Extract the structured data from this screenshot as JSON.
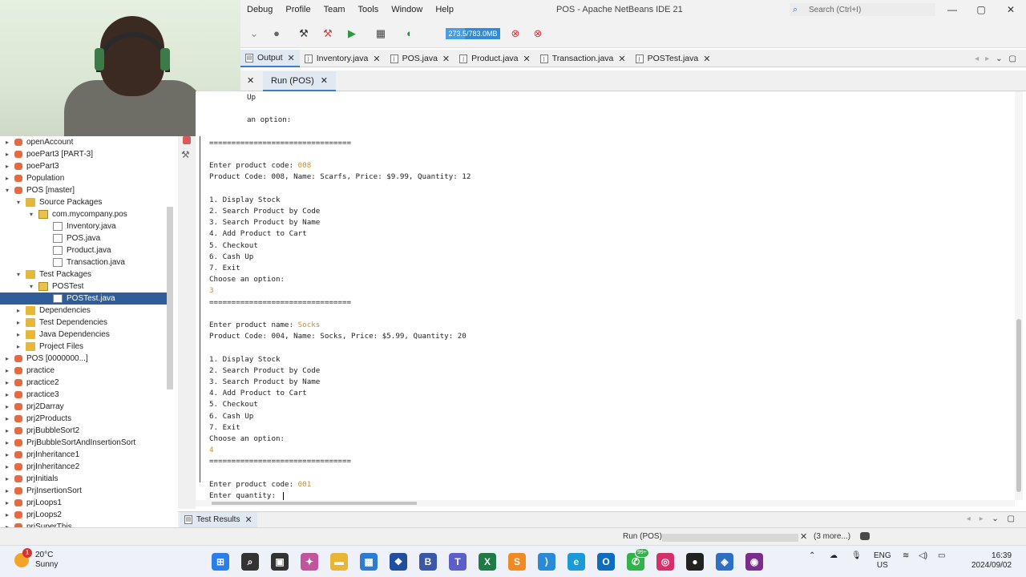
{
  "window": {
    "title": "POS - Apache NetBeans IDE 21",
    "search_placeholder": "Search (Ctrl+I)",
    "minimize": "—",
    "maximize": "▢",
    "close": "✕"
  },
  "menu": [
    "Debug",
    "Profile",
    "Team",
    "Tools",
    "Window",
    "Help"
  ],
  "toolbar": {
    "memory_label": "273.5/783.0MB",
    "memory_used_fraction": 0.35
  },
  "editor_tabs": [
    {
      "label": "Output",
      "active": true
    },
    {
      "label": "Inventory.java",
      "active": false
    },
    {
      "label": "POS.java",
      "active": false
    },
    {
      "label": "Product.java",
      "active": false
    },
    {
      "label": "Transaction.java",
      "active": false
    },
    {
      "label": "POSTest.java",
      "active": false
    }
  ],
  "output_tab": {
    "label": "Run (POS)"
  },
  "console_lines": [
    {
      "text": "Up",
      "input": ""
    },
    {
      "text": "",
      "input": ""
    },
    {
      "text": "an option:",
      "input": ""
    },
    {
      "text": "",
      "input": ""
    },
    {
      "text": "================================",
      "input": ""
    },
    {
      "text": "",
      "input": ""
    },
    {
      "text": "Enter product code: ",
      "input": "008"
    },
    {
      "text": "Product Code: 008, Name: Scarfs, Price: $9.99, Quantity: 12",
      "input": ""
    },
    {
      "text": "",
      "input": ""
    },
    {
      "text": "1. Display Stock",
      "input": ""
    },
    {
      "text": "2. Search Product by Code",
      "input": ""
    },
    {
      "text": "3. Search Product by Name",
      "input": ""
    },
    {
      "text": "4. Add Product to Cart",
      "input": ""
    },
    {
      "text": "5. Checkout",
      "input": ""
    },
    {
      "text": "6. Cash Up",
      "input": ""
    },
    {
      "text": "7. Exit",
      "input": ""
    },
    {
      "text": "Choose an option:",
      "input": ""
    },
    {
      "text": "",
      "input": "3"
    },
    {
      "text": "================================",
      "input": ""
    },
    {
      "text": "",
      "input": ""
    },
    {
      "text": "Enter product name: ",
      "input": "Socks"
    },
    {
      "text": "Product Code: 004, Name: Socks, Price: $5.99, Quantity: 20",
      "input": ""
    },
    {
      "text": "",
      "input": ""
    },
    {
      "text": "1. Display Stock",
      "input": ""
    },
    {
      "text": "2. Search Product by Code",
      "input": ""
    },
    {
      "text": "3. Search Product by Name",
      "input": ""
    },
    {
      "text": "4. Add Product to Cart",
      "input": ""
    },
    {
      "text": "5. Checkout",
      "input": ""
    },
    {
      "text": "6. Cash Up",
      "input": ""
    },
    {
      "text": "7. Exit",
      "input": ""
    },
    {
      "text": "Choose an option:",
      "input": ""
    },
    {
      "text": "",
      "input": "4"
    },
    {
      "text": "================================",
      "input": ""
    },
    {
      "text": "",
      "input": ""
    },
    {
      "text": "Enter product code: ",
      "input": "001"
    },
    {
      "text": "Enter quantity: ",
      "input": ""
    }
  ],
  "project_tree": [
    {
      "label": "openAccount",
      "level": 0,
      "icon": "proj",
      "exp": "▸"
    },
    {
      "label": "poePart3 [PART-3]",
      "level": 0,
      "icon": "proj",
      "exp": "▸"
    },
    {
      "label": "poePart3",
      "level": 0,
      "icon": "proj",
      "exp": "▸"
    },
    {
      "label": "Population",
      "level": 0,
      "icon": "proj",
      "exp": "▸"
    },
    {
      "label": "POS [master]",
      "level": 0,
      "icon": "proj",
      "exp": "▾"
    },
    {
      "label": "Source Packages",
      "level": 1,
      "icon": "folder",
      "exp": "▾"
    },
    {
      "label": "com.mycompany.pos",
      "level": 2,
      "icon": "pkg",
      "exp": "▾"
    },
    {
      "label": "Inventory.java",
      "level": 3,
      "icon": "file",
      "exp": ""
    },
    {
      "label": "POS.java",
      "level": 3,
      "icon": "file",
      "exp": ""
    },
    {
      "label": "Product.java",
      "level": 3,
      "icon": "file",
      "exp": ""
    },
    {
      "label": "Transaction.java",
      "level": 3,
      "icon": "file",
      "exp": ""
    },
    {
      "label": "Test Packages",
      "level": 1,
      "icon": "folder",
      "exp": "▾"
    },
    {
      "label": "POSTest",
      "level": 2,
      "icon": "pkg",
      "exp": "▾"
    },
    {
      "label": "POSTest.java",
      "level": 3,
      "icon": "file",
      "exp": "",
      "selected": true
    },
    {
      "label": "Dependencies",
      "level": 1,
      "icon": "folder",
      "exp": "▸"
    },
    {
      "label": "Test Dependencies",
      "level": 1,
      "icon": "folder",
      "exp": "▸"
    },
    {
      "label": "Java Dependencies",
      "level": 1,
      "icon": "folder",
      "exp": "▸"
    },
    {
      "label": "Project Files",
      "level": 1,
      "icon": "folder",
      "exp": "▸"
    },
    {
      "label": "POS [0000000...]",
      "level": 0,
      "icon": "proj",
      "exp": "▸"
    },
    {
      "label": "practice",
      "level": 0,
      "icon": "proj",
      "exp": "▸"
    },
    {
      "label": "practice2",
      "level": 0,
      "icon": "proj",
      "exp": "▸"
    },
    {
      "label": "practice3",
      "level": 0,
      "icon": "proj",
      "exp": "▸"
    },
    {
      "label": "prj2Darray",
      "level": 0,
      "icon": "proj",
      "exp": "▸"
    },
    {
      "label": "prj2Products",
      "level": 0,
      "icon": "proj",
      "exp": "▸"
    },
    {
      "label": "prjBubbleSort2",
      "level": 0,
      "icon": "proj",
      "exp": "▸"
    },
    {
      "label": "PrjBubbleSortAndInsertionSort",
      "level": 0,
      "icon": "proj",
      "exp": "▸"
    },
    {
      "label": "prjInheritance1",
      "level": 0,
      "icon": "proj",
      "exp": "▸"
    },
    {
      "label": "prjInheritance2",
      "level": 0,
      "icon": "proj",
      "exp": "▸"
    },
    {
      "label": "prjInitials",
      "level": 0,
      "icon": "proj",
      "exp": "▸"
    },
    {
      "label": "PrjInsertionSort",
      "level": 0,
      "icon": "proj",
      "exp": "▸"
    },
    {
      "label": "prjLoops1",
      "level": 0,
      "icon": "proj",
      "exp": "▸"
    },
    {
      "label": "prjLoops2",
      "level": 0,
      "icon": "proj",
      "exp": "▸"
    },
    {
      "label": "prjSuperThis",
      "level": 0,
      "icon": "proj",
      "exp": "▸"
    }
  ],
  "bottom_panel": {
    "tab_label": "Test Results"
  },
  "status": {
    "run_label": "Run (POS)",
    "more_label": "(3 more...)"
  },
  "taskbar": {
    "weather_temp": "20°C",
    "weather_desc": "Sunny",
    "weather_badge": "1",
    "whatsapp_badge": "99+",
    "lang_top": "ENG",
    "lang_bottom": "US",
    "time": "16:39",
    "date": "2024/09/02",
    "apps": [
      {
        "name": "windows-start-icon",
        "glyph": "⊞",
        "color": "#2b7de9"
      },
      {
        "name": "search-icon",
        "glyph": "⌕",
        "color": "#333333"
      },
      {
        "name": "task-view-icon",
        "glyph": "▣",
        "color": "#333333"
      },
      {
        "name": "copilot-icon",
        "glyph": "✦",
        "color": "#c2549e"
      },
      {
        "name": "file-explorer-icon",
        "glyph": "▬",
        "color": "#e8b634"
      },
      {
        "name": "store-icon",
        "glyph": "▦",
        "color": "#2e7bd4"
      },
      {
        "name": "dropbox-icon",
        "glyph": "❖",
        "color": "#1f4f9e"
      },
      {
        "name": "bootstrap-icon",
        "glyph": "B",
        "color": "#3a57a8"
      },
      {
        "name": "teams-icon",
        "glyph": "T",
        "color": "#5b5fc7"
      },
      {
        "name": "excel-icon",
        "glyph": "X",
        "color": "#1f7a45"
      },
      {
        "name": "sublime-icon",
        "glyph": "S",
        "color": "#f08a24"
      },
      {
        "name": "vscode-icon",
        "glyph": "⟩",
        "color": "#2a8ad6"
      },
      {
        "name": "edge-icon",
        "glyph": "e",
        "color": "#1a9ad6"
      },
      {
        "name": "outlook-icon",
        "glyph": "O",
        "color": "#0f6cbd"
      },
      {
        "name": "whatsapp-icon",
        "glyph": "✆",
        "color": "#2fb34a"
      },
      {
        "name": "instagram-icon",
        "glyph": "◎",
        "color": "#d6306a"
      },
      {
        "name": "github-icon",
        "glyph": "●",
        "color": "#222222"
      },
      {
        "name": "netbeans-icon",
        "glyph": "◈",
        "color": "#2c6fc4"
      },
      {
        "name": "obs-icon",
        "glyph": "◉",
        "color": "#7a2d8a"
      }
    ]
  }
}
